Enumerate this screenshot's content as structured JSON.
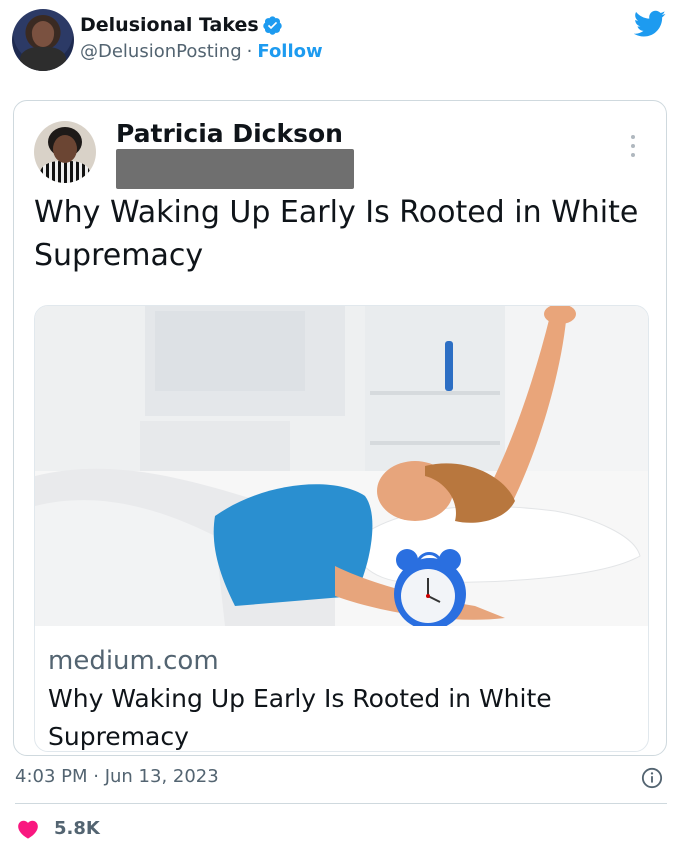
{
  "author": {
    "display_name": "Delusional Takes",
    "handle": "@DelusionPosting",
    "separator": "·",
    "follow_label": "Follow",
    "verified": true
  },
  "quoted": {
    "author_name": "Patricia Dickson",
    "text": "Why Waking Up Early Is Rooted in White Supremacy",
    "link_card": {
      "domain": "medium.com",
      "title": "Why Waking Up Early Is Rooted in White Supremacy"
    }
  },
  "meta": {
    "timestamp": "4:03 PM · Jun 13, 2023",
    "likes": "5.8K"
  },
  "icons": {
    "verified": "verified-badge-icon",
    "brand": "twitter-bird-icon",
    "more": "more-vertical-icon",
    "info": "info-icon",
    "like": "heart-icon"
  },
  "colors": {
    "accent": "#1d9bf0",
    "like": "#f91880",
    "secondary_text": "#536471",
    "border": "#cfd9de"
  }
}
